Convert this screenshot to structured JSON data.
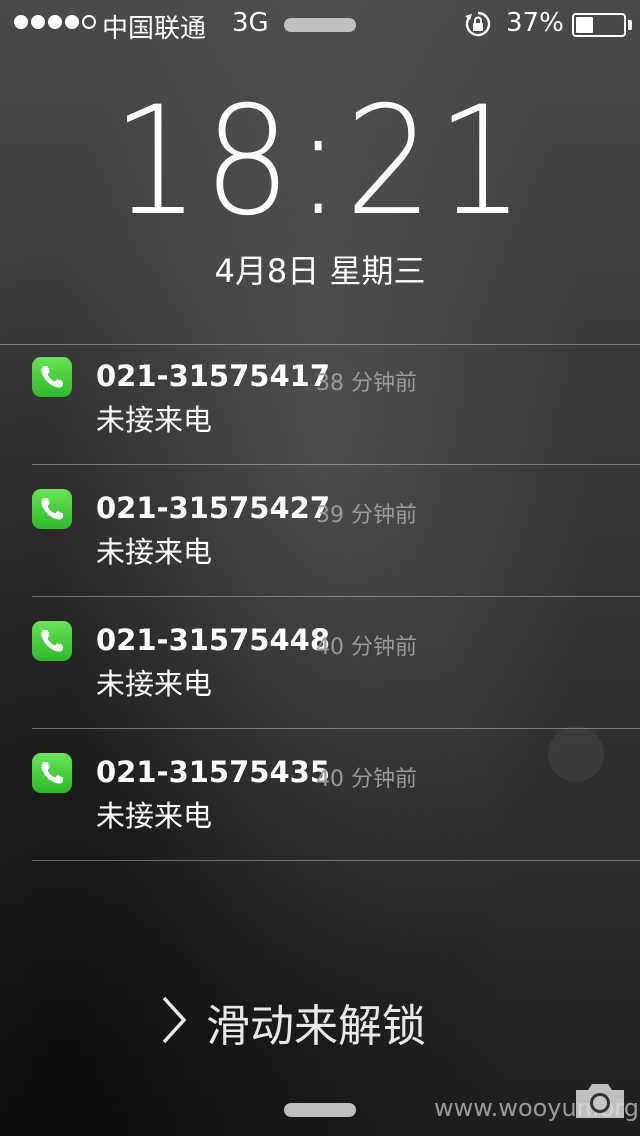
{
  "status_bar": {
    "signal_dots": [
      true,
      true,
      true,
      true,
      false
    ],
    "carrier": "中国联通",
    "network": "3G",
    "battery_percent_text": "37%",
    "battery_level": 0.37,
    "icons": [
      "orientation-lock-icon",
      "battery-icon"
    ]
  },
  "lockscreen": {
    "time": "18:21",
    "date": "4月8日 星期三"
  },
  "notifications": [
    {
      "caller": "021-31575417",
      "time_ago": "38 分钟前",
      "message": "未接来电",
      "icon": "phone-icon"
    },
    {
      "caller": "021-31575427",
      "time_ago": "39 分钟前",
      "message": "未接来电",
      "icon": "phone-icon"
    },
    {
      "caller": "021-31575448",
      "time_ago": "40 分钟前",
      "message": "未接来电",
      "icon": "phone-icon"
    },
    {
      "caller": "021-31575435",
      "time_ago": "40 分钟前",
      "message": "未接来电",
      "icon": "phone-icon"
    }
  ],
  "unlock": {
    "label": "滑动来解锁",
    "icon": "chevron-right-icon"
  },
  "bottom": {
    "camera_icon": "camera-icon",
    "watermark": "www.wooyun.org"
  },
  "colors": {
    "phone_green": "#4cd137",
    "text_secondary": "#9a9a9a"
  }
}
